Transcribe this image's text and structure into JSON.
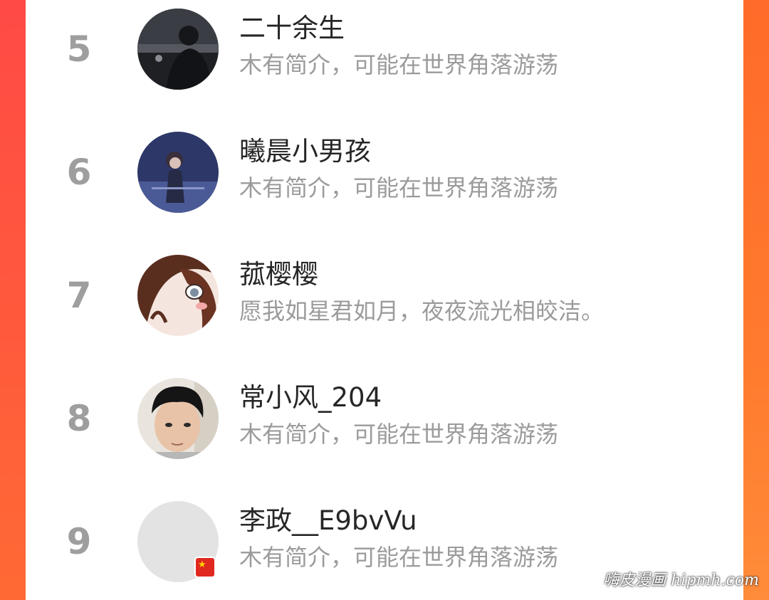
{
  "colors": {
    "background_left": "#ff4a46",
    "background_right": "#ff7a2e",
    "card": "#ffffff",
    "rank_text": "#9e9e9e",
    "name_text": "#262626",
    "bio_text": "#9b9b9b"
  },
  "users": [
    {
      "rank": "5",
      "name": "二十余生",
      "bio": "木有简介，可能在世界角落游荡",
      "avatar": "dark-silhouette-avatar"
    },
    {
      "rank": "6",
      "name": "曦晨小男孩",
      "bio": "木有简介，可能在世界角落游荡",
      "avatar": "anime-boy-avatar"
    },
    {
      "rank": "7",
      "name": "菰樱樱",
      "bio": "愿我如星君如月，夜夜流光相皎洁。",
      "avatar": "anime-girl-avatar"
    },
    {
      "rank": "8",
      "name": "常小风_204",
      "bio": "木有简介，可能在世界角落游荡",
      "avatar": "photo-boy-avatar"
    },
    {
      "rank": "9",
      "name": "李政__E9bvVu",
      "bio": "木有简介，可能在世界角落游荡",
      "avatar": "default-gray-avatar",
      "badge": "flag-badge-icon"
    }
  ],
  "watermark": "嗨皮漫画 hipmh.com"
}
